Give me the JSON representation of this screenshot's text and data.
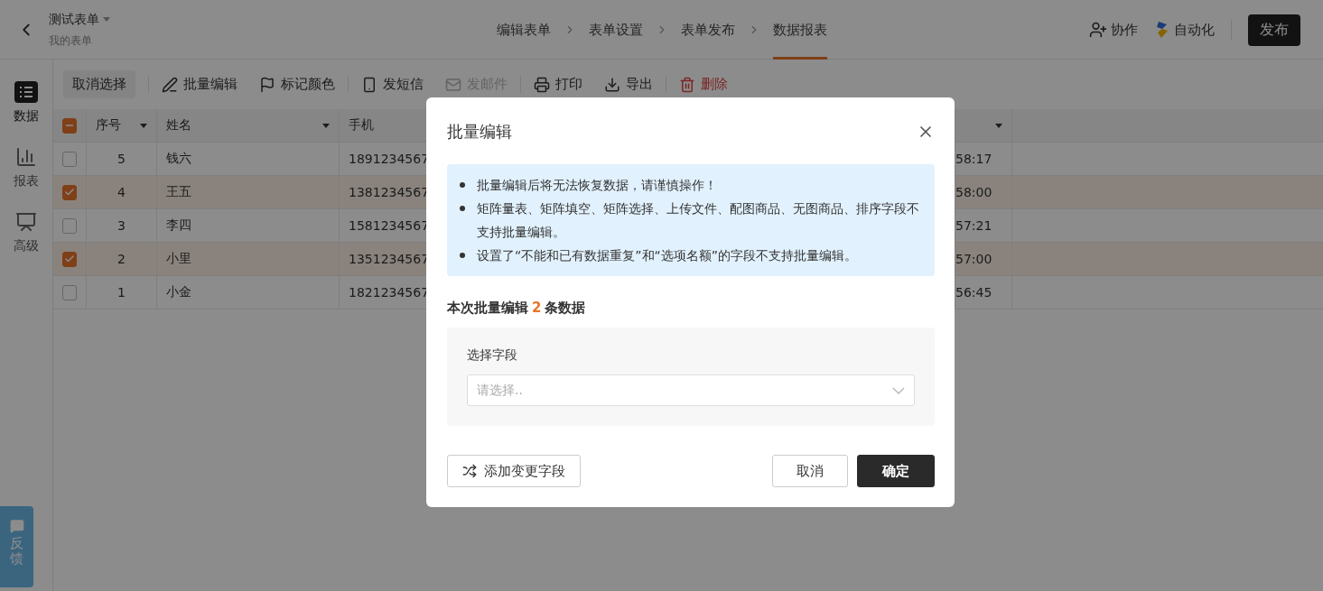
{
  "header": {
    "title": "测试表单",
    "subtitle": "我的表单",
    "steps": [
      {
        "label": "编辑表单",
        "selected": false
      },
      {
        "label": "表单设置",
        "selected": false
      },
      {
        "label": "表单发布",
        "selected": false
      },
      {
        "label": "数据报表",
        "selected": true
      }
    ],
    "actions": [
      {
        "label": "协作",
        "kind": "collab"
      },
      {
        "label": "自动化",
        "kind": "auto"
      }
    ],
    "publish": "发布"
  },
  "sidebar": {
    "items": [
      {
        "label": "数据",
        "selected": true
      },
      {
        "label": "报表",
        "selected": false
      },
      {
        "label": "高级",
        "selected": false
      }
    ]
  },
  "toolbar": {
    "groups": [
      [
        {
          "label": "取消选择",
          "kind": "plain",
          "disabled": false
        }
      ],
      [
        {
          "label": "批量编辑",
          "kind": "edit",
          "disabled": false
        },
        {
          "label": "标记颜色",
          "kind": "flag",
          "disabled": false
        }
      ],
      [
        {
          "label": "发短信",
          "kind": "sms",
          "disabled": false
        },
        {
          "label": "发邮件",
          "kind": "mail",
          "disabled": true
        }
      ],
      [
        {
          "label": "打印",
          "kind": "print",
          "disabled": false
        },
        {
          "label": "导出",
          "kind": "export",
          "disabled": false
        }
      ],
      [
        {
          "label": "删除",
          "kind": "delete",
          "disabled": false
        }
      ]
    ]
  },
  "table": {
    "indeterminate": true,
    "columns": [
      {
        "label": "序号",
        "sortable": true
      },
      {
        "label": "姓名",
        "sortable": true
      },
      {
        "label": "手机",
        "sortable": false
      },
      {
        "sortable": true
      }
    ],
    "rows": [
      {
        "seq": "5",
        "name": "钱六",
        "phone": "1891234567",
        "time": "58:17",
        "selected": false
      },
      {
        "seq": "4",
        "name": "王五",
        "phone": "1381234567",
        "time": "58:00",
        "selected": true
      },
      {
        "seq": "3",
        "name": "李四",
        "phone": "1581234567",
        "time": "57:21",
        "selected": false
      },
      {
        "seq": "2",
        "name": "小里",
        "phone": "1351234567",
        "time": "57:00",
        "selected": true
      },
      {
        "seq": "1",
        "name": "小金",
        "phone": "1821234567",
        "time": "56:45",
        "selected": false
      }
    ]
  },
  "feedback": {
    "label": "反馈"
  },
  "dialog": {
    "title": "批量编辑",
    "notes": [
      "批量编辑后将无法恢复数据，请谨慎操作！",
      "矩阵量表、矩阵填空、矩阵选择、上传文件、配图商品、无图商品、排序字段不支持批量编辑。",
      "设置了“不能和已有数据重复”和“选项名额”的字段不支持批量编辑。"
    ],
    "summary": {
      "prefix": "本次批量编辑",
      "count": "2",
      "suffix": "条数据"
    },
    "field": {
      "label": "选择字段",
      "placeholder": "请选择.."
    },
    "add_button": "添加变更字段",
    "cancel": "取消",
    "confirm": "确定"
  }
}
